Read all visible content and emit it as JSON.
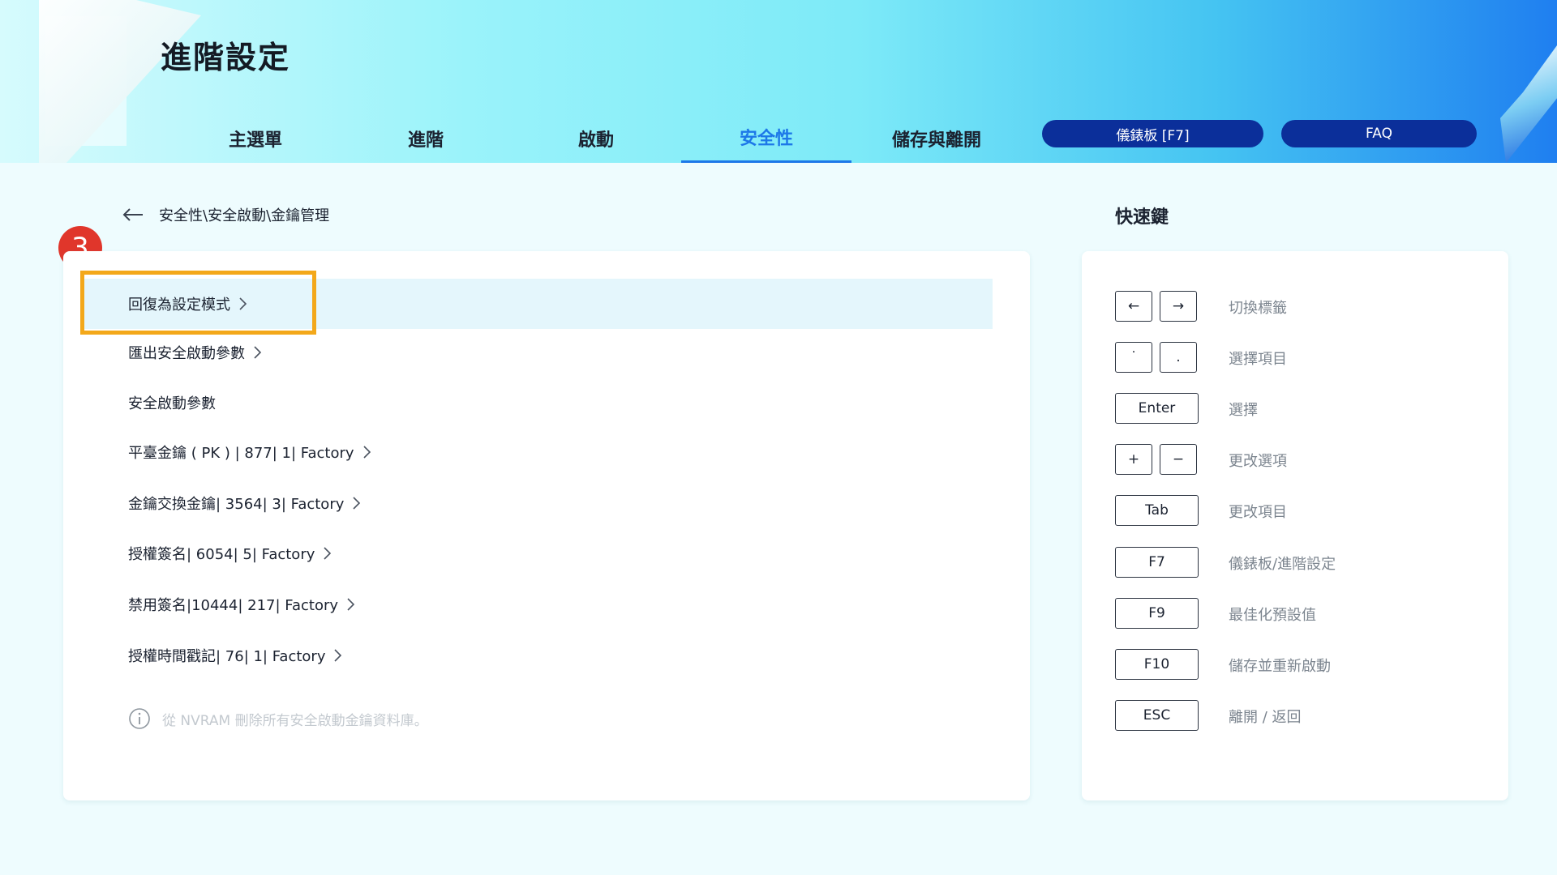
{
  "header": {
    "title": "進階設定",
    "tabs": [
      {
        "label": "主選單",
        "active": false
      },
      {
        "label": "進階",
        "active": false
      },
      {
        "label": "啟動",
        "active": false
      },
      {
        "label": "安全性",
        "active": true
      },
      {
        "label": "儲存與離開",
        "active": false
      }
    ],
    "buttons": {
      "dashboard": "儀錶板 [F7]",
      "faq": "FAQ"
    }
  },
  "breadcrumb": {
    "path": "安全性\\安全啟動\\金鑰管理"
  },
  "step_badge": "3",
  "menu": {
    "items": [
      {
        "label": "回復為設定模式",
        "has_arrow": true,
        "selected": true
      },
      {
        "label": "匯出安全啟動參數",
        "has_arrow": true,
        "selected": false
      },
      {
        "label": "安全啟動參數",
        "has_arrow": false,
        "selected": false
      },
      {
        "label": "平臺金鑰 ( PK ) | 877|   1| Factory",
        "has_arrow": true,
        "selected": false
      },
      {
        "label": "金鑰交換金鑰| 3564|   3| Factory",
        "has_arrow": true,
        "selected": false
      },
      {
        "label": "授權簽名| 6054|   5| Factory",
        "has_arrow": true,
        "selected": false
      },
      {
        "label": "禁用簽名|10444|  217| Factory",
        "has_arrow": true,
        "selected": false
      },
      {
        "label": "授權時間戳記|  76|   1| Factory",
        "has_arrow": true,
        "selected": false
      }
    ],
    "info_text": "從 NVRAM 刪除所有安全啟動金鑰資料庫。"
  },
  "shortcuts": {
    "title": "快速鍵",
    "rows": [
      {
        "keys": [
          "←",
          "→"
        ],
        "desc": "切換標籤"
      },
      {
        "keys": [
          "˙",
          "."
        ],
        "desc": "選擇項目"
      },
      {
        "keys": [
          "Enter"
        ],
        "desc": "選擇"
      },
      {
        "keys": [
          "+",
          "−"
        ],
        "desc": "更改選項"
      },
      {
        "keys": [
          "Tab"
        ],
        "desc": "更改項目"
      },
      {
        "keys": [
          "F7"
        ],
        "desc": "儀錶板/進階設定"
      },
      {
        "keys": [
          "F9"
        ],
        "desc": "最佳化預設值"
      },
      {
        "keys": [
          "F10"
        ],
        "desc": "儲存並重新啟動"
      },
      {
        "keys": [
          "ESC"
        ],
        "desc": "離開 / 返回"
      }
    ]
  },
  "colors": {
    "accent": "#1d78e8",
    "pill": "#0b2f9a",
    "highlight": "#f3a81a",
    "badge": "#e0362b",
    "selected_row": "#e4f6fc"
  }
}
